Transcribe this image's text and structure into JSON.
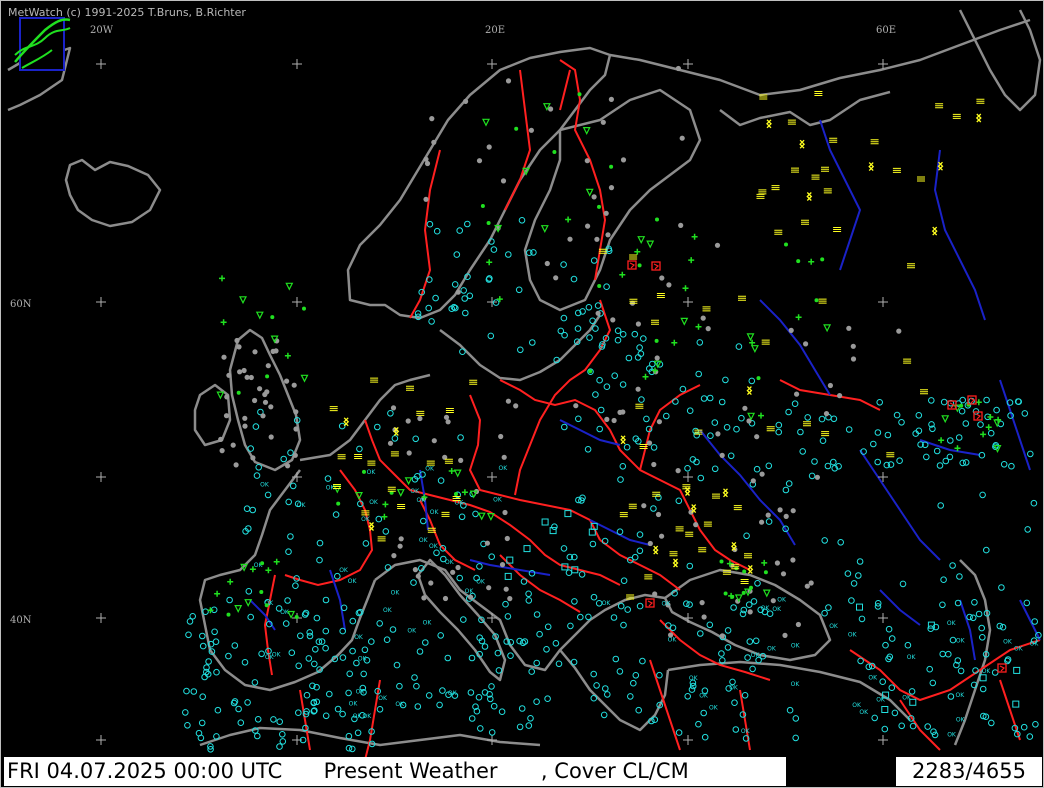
{
  "credit": "MetWatch  (c) 1991-2025 T.Bruns, B.Richter",
  "graticule_labels": {
    "lon_20w": "20W",
    "lon_20e": "20E",
    "lon_60e": "60E",
    "lat_60n": "60N",
    "lat_40n": "40N"
  },
  "status_bar": {
    "datetime": "FRI 04.07.2025 00:00 UTC",
    "parameter": "Present Weather",
    "separator": ",",
    "cover": "Cover CL/CM",
    "count": "2283/4655"
  },
  "symbol_names": {
    "clear": "station-clear-icon",
    "cloudy": "station-cloudy-icon",
    "ok": "ok",
    "fog": "fog-icon",
    "rain": "rain-icon",
    "thunder": "thunderstorm-icon",
    "haze": "haze-icon"
  },
  "colors": {
    "background": "#000000",
    "coastline": "#8c8c8c",
    "border": "#ff2020",
    "river": "#1a22c8",
    "station_clear": "#22e0e0",
    "station_cloudy": "#9a9a9a",
    "precip": "#20e020",
    "haze": "#ffff20",
    "thunder_red": "#ff2020"
  }
}
